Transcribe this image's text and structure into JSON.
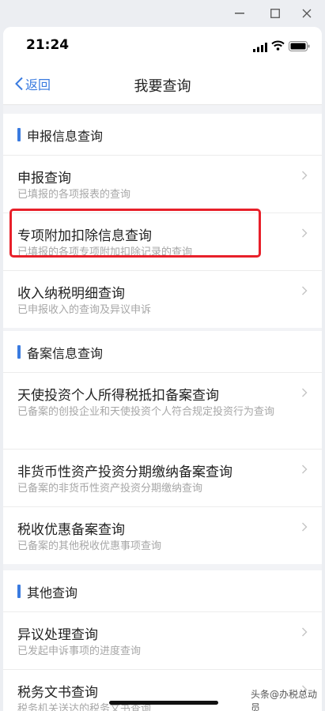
{
  "status_bar": {
    "time": "21:24"
  },
  "nav": {
    "back_label": "返回",
    "title": "我要查询"
  },
  "sections": [
    {
      "title": "申报信息查询",
      "items": [
        {
          "title": "申报查询",
          "subtitle": "已填报的各项报表的查询"
        },
        {
          "title": "专项附加扣除信息查询",
          "subtitle": "已填报的各项专项附加扣除记录的查询",
          "highlighted": true
        },
        {
          "title": "收入纳税明细查询",
          "subtitle": "已申报收入的查询及异议申诉"
        }
      ]
    },
    {
      "title": "备案信息查询",
      "items": [
        {
          "title": "天使投资个人所得税抵扣备案查询",
          "subtitle": "已备案的创投企业和天使投资个人符合规定投资行为查询"
        },
        {
          "title": "非货币性资产投资分期缴纳备案查询",
          "subtitle": "已备案的非货币性资产投资分期缴纳查询"
        },
        {
          "title": "税收优惠备案查询",
          "subtitle": "已备案的其他税收优惠事项查询"
        }
      ]
    },
    {
      "title": "其他查询",
      "items": [
        {
          "title": "异议处理查询",
          "subtitle": "已发起申诉事项的进度查询"
        },
        {
          "title": "税务文书查询",
          "subtitle": "税务机关送达的税务文书查询"
        }
      ]
    }
  ],
  "watermark": "头条@办税总动员",
  "colors": {
    "accent": "#3a7be0",
    "highlight_border": "#e8202a",
    "background": "#f2f3f6"
  }
}
